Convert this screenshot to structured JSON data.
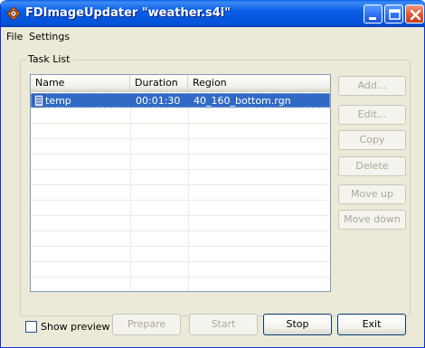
{
  "window": {
    "title": "FDImageUpdater \"weather.s4i\""
  },
  "menu": {
    "items": [
      "File",
      "Settings"
    ]
  },
  "task_list": {
    "group_label": "Task List",
    "columns": [
      "Name",
      "Duration",
      "Region"
    ],
    "rows": [
      {
        "name": "temp",
        "duration": "00:01:30",
        "region": "40_160_bottom.rgn",
        "selected": true
      }
    ]
  },
  "side_buttons": {
    "add": "Add...",
    "edit": "Edit...",
    "copy": "Copy",
    "delete": "Delete",
    "move_up": "Move up",
    "move_down": "Move down"
  },
  "bottom": {
    "show_preview_label": "Show preview",
    "show_preview_checked": false,
    "prepare": "Prepare",
    "start": "Start",
    "stop": "Stop",
    "exit": "Exit"
  },
  "colors": {
    "title_bar": "#0a5ce6",
    "selection": "#316ac5",
    "face": "#ece9d8",
    "close_button": "#e2552f"
  },
  "icons": {
    "app": "diamond-target-icon",
    "task": "task-list-icon",
    "minimize": "minimize-icon",
    "maximize": "maximize-icon",
    "close": "close-icon"
  }
}
